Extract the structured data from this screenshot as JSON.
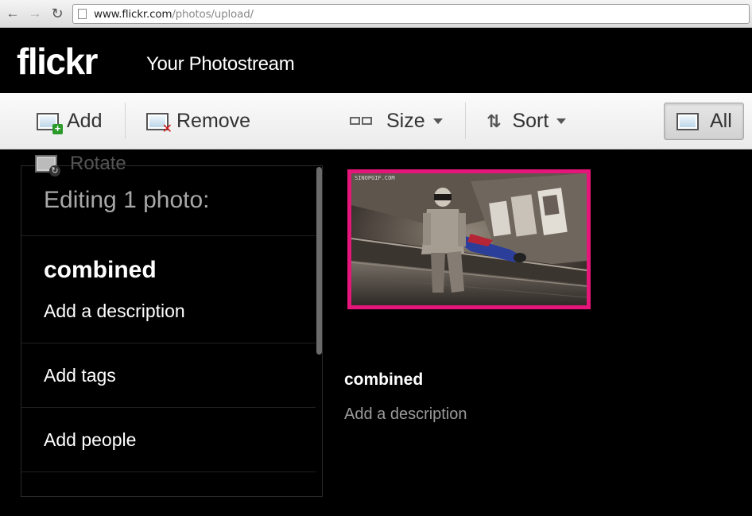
{
  "browser": {
    "url_host": "www.flickr.com",
    "url_path": "/photos/upload/"
  },
  "header": {
    "logo": "flickr",
    "title": "Your Photostream"
  },
  "toolbar": {
    "add_label": "Add",
    "remove_label": "Remove",
    "size_label": "Size",
    "sort_label": "Sort",
    "all_label": "All",
    "rotate_label": "Rotate"
  },
  "edit_panel": {
    "heading": "Editing 1 photo:",
    "photo_title": "combined",
    "description_placeholder": "Add a description",
    "tags_placeholder": "Add tags",
    "people_placeholder": "Add people"
  },
  "photo": {
    "watermark": "SINOPGIF.COM",
    "caption_title": "combined",
    "caption_description": "Add a description",
    "selected": true
  },
  "colors": {
    "selection_border": "#e5157a",
    "background": "#000000"
  }
}
